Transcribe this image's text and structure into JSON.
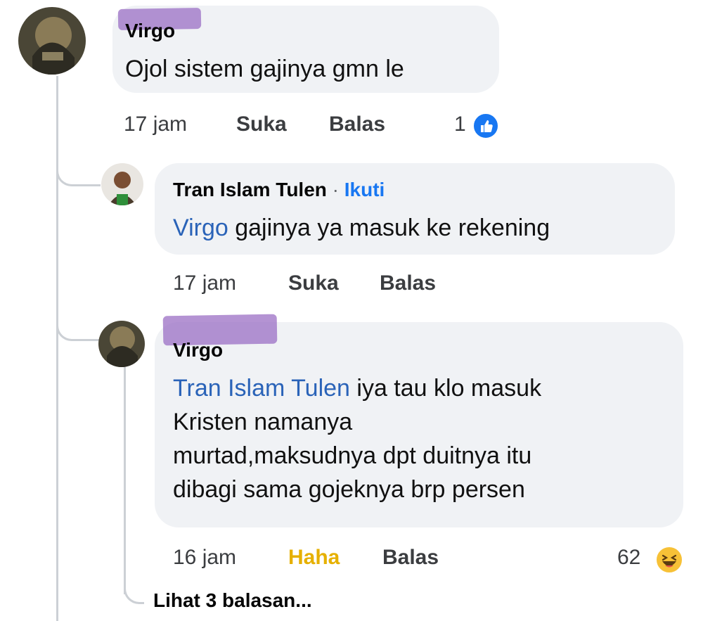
{
  "comments": [
    {
      "author": "Virgo",
      "text": "Ojol sistem gajinya gmn le",
      "time": "17 jam",
      "like_label": "Suka",
      "reply_label": "Balas",
      "reaction_count": "1",
      "reaction_icon": "like-icon"
    }
  ],
  "replies": [
    {
      "author": "Tran Islam Tulen",
      "separator": "·",
      "follow_label": "Ikuti",
      "mention": "Virgo",
      "text": " gajinya ya masuk ke rekening",
      "time": "17 jam",
      "like_label": "Suka",
      "reply_label": "Balas"
    },
    {
      "author": "Virgo",
      "mention": "Tran Islam Tulen",
      "lines": [
        " iya tau klo masuk",
        "Kristen namanya",
        "murtad,maksudnya dpt duitnya itu",
        "dibagi sama gojeknya brp persen"
      ],
      "time": "16 jam",
      "like_label": "Haha",
      "reply_label": "Balas",
      "reaction_count": "62",
      "reaction_icon": "haha-icon"
    }
  ],
  "view_more": "Lihat 3 balasan...",
  "colors": {
    "bubble": "#f0f2f5",
    "mention": "#2a63b8",
    "follow": "#1877f2",
    "haha": "#e6b000",
    "redaction": "#9b6fc4"
  }
}
